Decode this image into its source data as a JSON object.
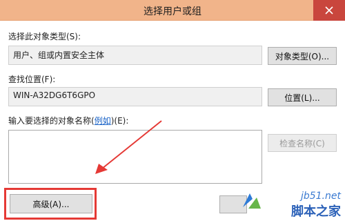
{
  "window": {
    "title": "选择用户或组"
  },
  "object_type": {
    "label": "选择此对象类型(S):",
    "value": "用户、组或内置安全主体",
    "button": "对象类型(O)..."
  },
  "location": {
    "label": "查找位置(F):",
    "value": "WIN-A32DG6T6GPO",
    "button": "位置(L)..."
  },
  "names": {
    "label_prefix": "输入要选择的对象名称(",
    "label_link": "例如",
    "label_suffix": ")(E):",
    "value": "",
    "check_button": "检查名称(C)"
  },
  "advanced_button": "高级(A)...",
  "watermark": {
    "top": "jb51.net",
    "bottom": "脚本之家"
  },
  "colors": {
    "titlebar": "#f1b48a",
    "close": "#c9463d",
    "highlight": "#e53935"
  }
}
